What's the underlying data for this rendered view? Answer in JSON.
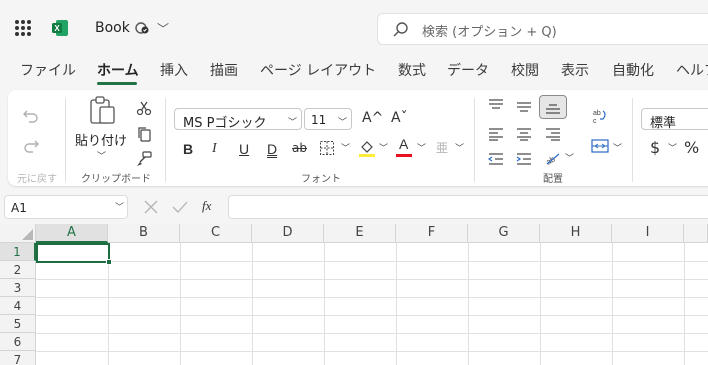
{
  "app": {
    "book_title": "Book",
    "search_placeholder": "検索 (オプション + Q)"
  },
  "menu_tabs": [
    {
      "label": "ファイル",
      "active": false
    },
    {
      "label": "ホーム",
      "active": true
    },
    {
      "label": "挿入",
      "active": false
    },
    {
      "label": "描画",
      "active": false
    },
    {
      "label": "ページ レイアウト",
      "active": false
    },
    {
      "label": "数式",
      "active": false
    },
    {
      "label": "データ",
      "active": false
    },
    {
      "label": "校閲",
      "active": false
    },
    {
      "label": "表示",
      "active": false
    },
    {
      "label": "自動化",
      "active": false
    },
    {
      "label": "ヘルプ",
      "active": false
    }
  ],
  "ribbon": {
    "undo_group_label": "元に戻す",
    "paste_label": "貼り付け",
    "clipboard_group_label": "クリップボード",
    "font_name": "MS Pゴシック",
    "font_size": "11",
    "font_group_label": "フォント",
    "alignment_group_label": "配置",
    "number_format": "標準",
    "currency_symbol": "$",
    "percent_symbol": "%",
    "bold_label": "B",
    "italic_label": "I",
    "underline_label": "U",
    "double_underline_label": "D",
    "strike_label": "ab",
    "increase_font_label": "A^",
    "decrease_font_label": "Aˇ",
    "font_color_letter": "A",
    "furigana_label": "亜"
  },
  "colors": {
    "accent_green": "#217346",
    "highlight_yellow": "#ffeb3b",
    "font_red": "#e81123"
  },
  "formula_bar": {
    "cell_ref": "A1",
    "fx_label": "fx",
    "value": ""
  },
  "grid": {
    "columns": [
      "A",
      "B",
      "C",
      "D",
      "E",
      "F",
      "G",
      "H",
      "I"
    ],
    "rows": [
      "1",
      "2",
      "3",
      "4",
      "5",
      "6",
      "7"
    ],
    "active_cell": "A1"
  }
}
